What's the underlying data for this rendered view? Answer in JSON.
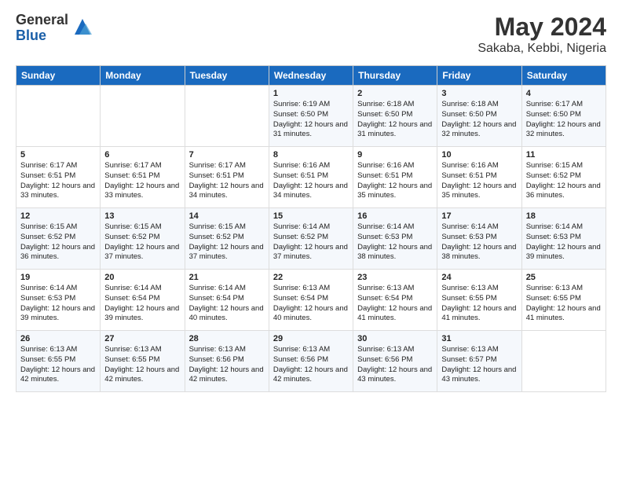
{
  "header": {
    "logo_general": "General",
    "logo_blue": "Blue",
    "main_title": "May 2024",
    "subtitle": "Sakaba, Kebbi, Nigeria"
  },
  "days_of_week": [
    "Sunday",
    "Monday",
    "Tuesday",
    "Wednesday",
    "Thursday",
    "Friday",
    "Saturday"
  ],
  "weeks": [
    [
      {
        "day": "",
        "info": ""
      },
      {
        "day": "",
        "info": ""
      },
      {
        "day": "",
        "info": ""
      },
      {
        "day": "1",
        "info": "Sunrise: 6:19 AM\nSunset: 6:50 PM\nDaylight: 12 hours and 31 minutes."
      },
      {
        "day": "2",
        "info": "Sunrise: 6:18 AM\nSunset: 6:50 PM\nDaylight: 12 hours and 31 minutes."
      },
      {
        "day": "3",
        "info": "Sunrise: 6:18 AM\nSunset: 6:50 PM\nDaylight: 12 hours and 32 minutes."
      },
      {
        "day": "4",
        "info": "Sunrise: 6:17 AM\nSunset: 6:50 PM\nDaylight: 12 hours and 32 minutes."
      }
    ],
    [
      {
        "day": "5",
        "info": "Sunrise: 6:17 AM\nSunset: 6:51 PM\nDaylight: 12 hours and 33 minutes."
      },
      {
        "day": "6",
        "info": "Sunrise: 6:17 AM\nSunset: 6:51 PM\nDaylight: 12 hours and 33 minutes."
      },
      {
        "day": "7",
        "info": "Sunrise: 6:17 AM\nSunset: 6:51 PM\nDaylight: 12 hours and 34 minutes."
      },
      {
        "day": "8",
        "info": "Sunrise: 6:16 AM\nSunset: 6:51 PM\nDaylight: 12 hours and 34 minutes."
      },
      {
        "day": "9",
        "info": "Sunrise: 6:16 AM\nSunset: 6:51 PM\nDaylight: 12 hours and 35 minutes."
      },
      {
        "day": "10",
        "info": "Sunrise: 6:16 AM\nSunset: 6:51 PM\nDaylight: 12 hours and 35 minutes."
      },
      {
        "day": "11",
        "info": "Sunrise: 6:15 AM\nSunset: 6:52 PM\nDaylight: 12 hours and 36 minutes."
      }
    ],
    [
      {
        "day": "12",
        "info": "Sunrise: 6:15 AM\nSunset: 6:52 PM\nDaylight: 12 hours and 36 minutes."
      },
      {
        "day": "13",
        "info": "Sunrise: 6:15 AM\nSunset: 6:52 PM\nDaylight: 12 hours and 37 minutes."
      },
      {
        "day": "14",
        "info": "Sunrise: 6:15 AM\nSunset: 6:52 PM\nDaylight: 12 hours and 37 minutes."
      },
      {
        "day": "15",
        "info": "Sunrise: 6:14 AM\nSunset: 6:52 PM\nDaylight: 12 hours and 37 minutes."
      },
      {
        "day": "16",
        "info": "Sunrise: 6:14 AM\nSunset: 6:53 PM\nDaylight: 12 hours and 38 minutes."
      },
      {
        "day": "17",
        "info": "Sunrise: 6:14 AM\nSunset: 6:53 PM\nDaylight: 12 hours and 38 minutes."
      },
      {
        "day": "18",
        "info": "Sunrise: 6:14 AM\nSunset: 6:53 PM\nDaylight: 12 hours and 39 minutes."
      }
    ],
    [
      {
        "day": "19",
        "info": "Sunrise: 6:14 AM\nSunset: 6:53 PM\nDaylight: 12 hours and 39 minutes."
      },
      {
        "day": "20",
        "info": "Sunrise: 6:14 AM\nSunset: 6:54 PM\nDaylight: 12 hours and 39 minutes."
      },
      {
        "day": "21",
        "info": "Sunrise: 6:14 AM\nSunset: 6:54 PM\nDaylight: 12 hours and 40 minutes."
      },
      {
        "day": "22",
        "info": "Sunrise: 6:13 AM\nSunset: 6:54 PM\nDaylight: 12 hours and 40 minutes."
      },
      {
        "day": "23",
        "info": "Sunrise: 6:13 AM\nSunset: 6:54 PM\nDaylight: 12 hours and 41 minutes."
      },
      {
        "day": "24",
        "info": "Sunrise: 6:13 AM\nSunset: 6:55 PM\nDaylight: 12 hours and 41 minutes."
      },
      {
        "day": "25",
        "info": "Sunrise: 6:13 AM\nSunset: 6:55 PM\nDaylight: 12 hours and 41 minutes."
      }
    ],
    [
      {
        "day": "26",
        "info": "Sunrise: 6:13 AM\nSunset: 6:55 PM\nDaylight: 12 hours and 42 minutes."
      },
      {
        "day": "27",
        "info": "Sunrise: 6:13 AM\nSunset: 6:55 PM\nDaylight: 12 hours and 42 minutes."
      },
      {
        "day": "28",
        "info": "Sunrise: 6:13 AM\nSunset: 6:56 PM\nDaylight: 12 hours and 42 minutes."
      },
      {
        "day": "29",
        "info": "Sunrise: 6:13 AM\nSunset: 6:56 PM\nDaylight: 12 hours and 42 minutes."
      },
      {
        "day": "30",
        "info": "Sunrise: 6:13 AM\nSunset: 6:56 PM\nDaylight: 12 hours and 43 minutes."
      },
      {
        "day": "31",
        "info": "Sunrise: 6:13 AM\nSunset: 6:57 PM\nDaylight: 12 hours and 43 minutes."
      },
      {
        "day": "",
        "info": ""
      }
    ]
  ]
}
